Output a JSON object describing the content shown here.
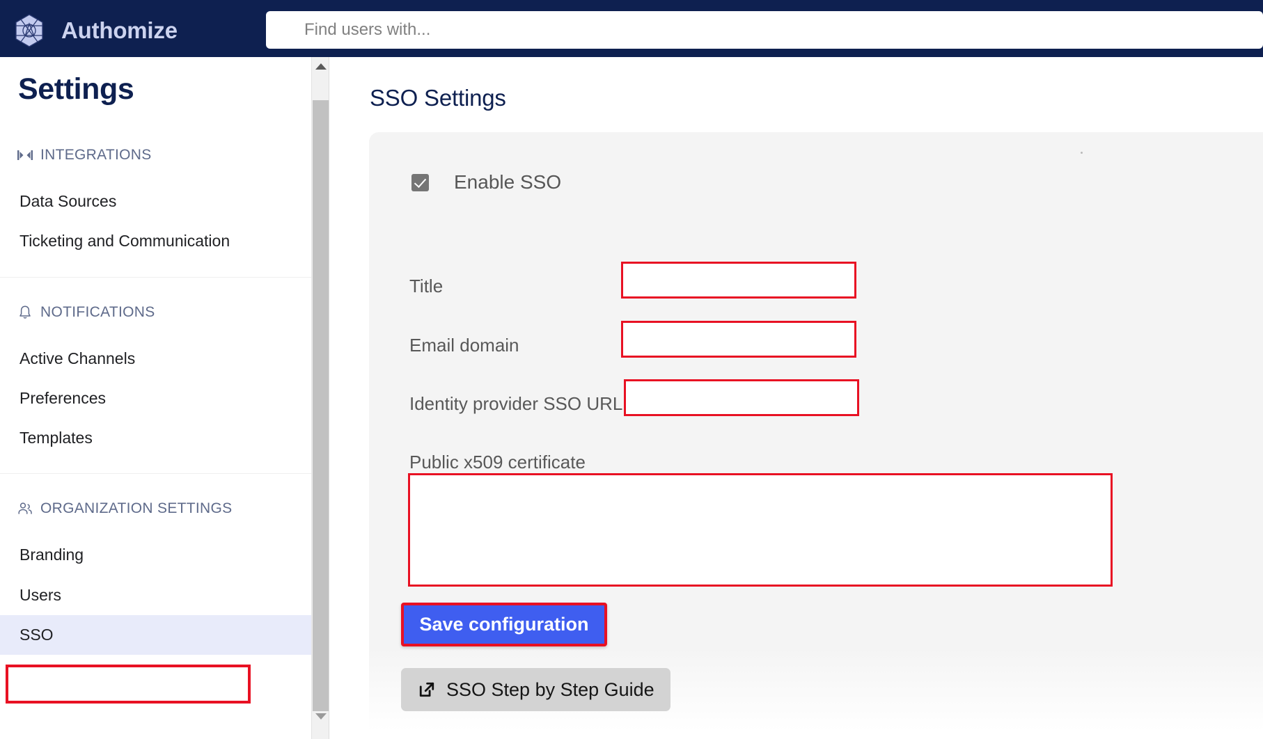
{
  "header": {
    "brand": "Authomize",
    "logo_icon": "authomize-hexagon-logo",
    "search_placeholder": "Find users with...",
    "search_value": "",
    "navy": "#0e2050"
  },
  "sidebar": {
    "title": "Settings",
    "sections": [
      {
        "icon": "integrations-connector-icon",
        "label": "INTEGRATIONS",
        "items": [
          {
            "label": "Data Sources",
            "active": false
          },
          {
            "label": "Ticketing and Communication",
            "active": false
          }
        ]
      },
      {
        "icon": "bell-icon",
        "label": "NOTIFICATIONS",
        "items": [
          {
            "label": "Active Channels",
            "active": false
          },
          {
            "label": "Preferences",
            "active": false
          },
          {
            "label": "Templates",
            "active": false
          }
        ]
      },
      {
        "icon": "users-group-icon",
        "label": "ORGANIZATION SETTINGS",
        "items": [
          {
            "label": "Branding",
            "active": false
          },
          {
            "label": "Users",
            "active": false
          },
          {
            "label": "SSO",
            "active": true
          }
        ]
      }
    ],
    "scrollbar": {
      "up_icon": "caret-up-icon",
      "down_icon": "caret-down-icon"
    }
  },
  "main": {
    "page_title": "SSO Settings",
    "enable_sso": {
      "label": "Enable SSO",
      "checked": true
    },
    "fields": [
      {
        "label": "Title",
        "value": "",
        "placeholder": "",
        "type": "text"
      },
      {
        "label": "Email domain",
        "value": "",
        "placeholder": "",
        "type": "text"
      },
      {
        "label": "Identity provider SSO URL",
        "value": "",
        "placeholder": "",
        "type": "text"
      },
      {
        "label": "Public x509 certificate",
        "value": "",
        "placeholder": "",
        "type": "textarea"
      }
    ],
    "save_button": "Save configuration",
    "guide_button": "SSO Step by Step Guide",
    "guide_icon": "external-link-icon"
  },
  "annotations": {
    "highlight_color": "#e81123",
    "targets": [
      "sidebar-item-sso",
      "title-input",
      "email-domain-input",
      "identity-provider-sso-url-input",
      "public-x509-certificate-textarea",
      "save-configuration-button"
    ]
  }
}
